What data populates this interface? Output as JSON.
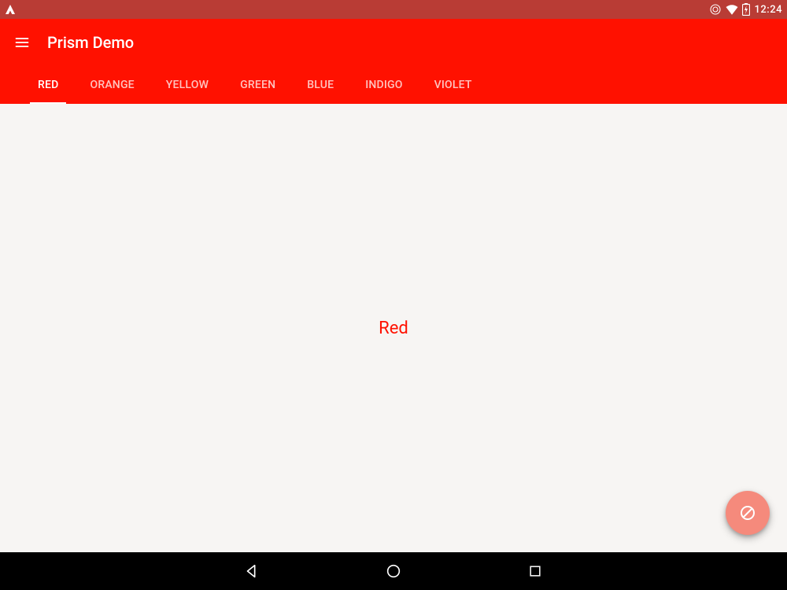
{
  "status": {
    "time": "12:24"
  },
  "appbar": {
    "title": "Prism Demo"
  },
  "tabs": [
    {
      "label": "RED",
      "active": true
    },
    {
      "label": "ORANGE",
      "active": false
    },
    {
      "label": "YELLOW",
      "active": false
    },
    {
      "label": "GREEN",
      "active": false
    },
    {
      "label": "BLUE",
      "active": false
    },
    {
      "label": "INDIGO",
      "active": false
    },
    {
      "label": "VIOLET",
      "active": false
    }
  ],
  "content": {
    "label": "Red"
  },
  "colors": {
    "primary": "#ff1100",
    "statusbar": "#b93c35",
    "fab": "#f58a7c"
  }
}
